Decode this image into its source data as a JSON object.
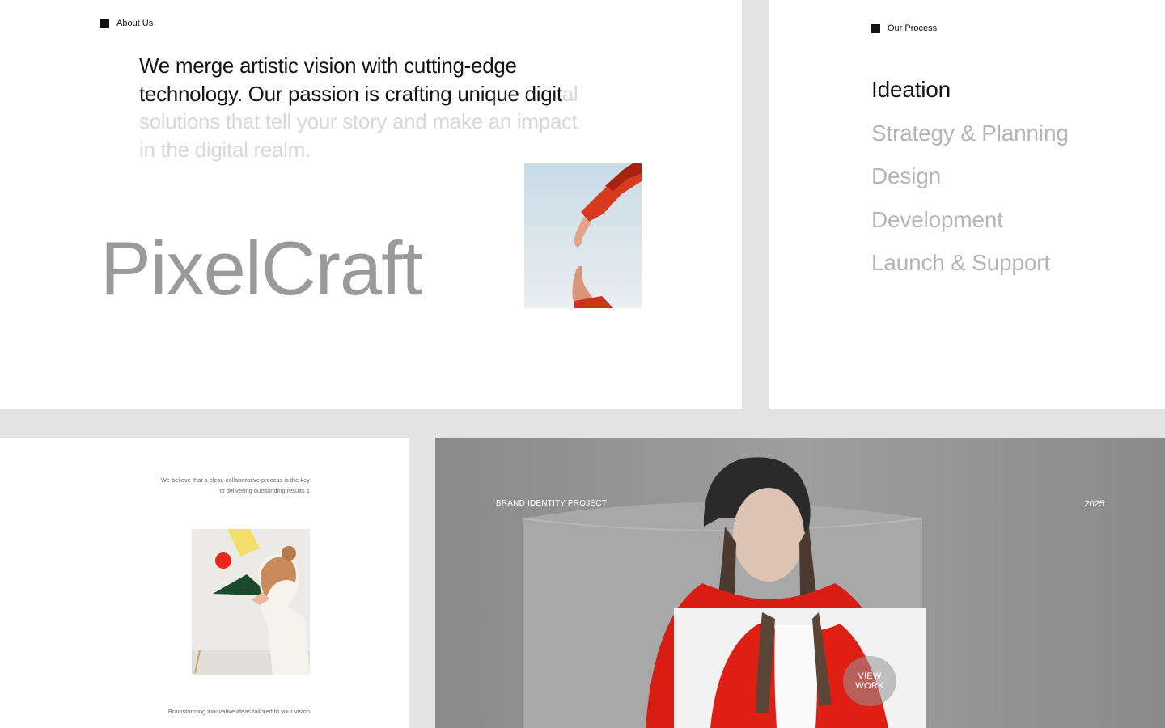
{
  "about": {
    "tag_label": "About Us",
    "lead_dark_1": "We merge artistic vision with cutting-edge",
    "lead_dark_2": "technology. Our passion is crafting unique digit",
    "lead_light_tail": "al",
    "lead_light_1": "solutions that tell your story and make an impact",
    "lead_light_2": "in the digital realm.",
    "brand_name": "PixelCraft"
  },
  "process": {
    "tag_label": "Our Process",
    "steps": [
      "Ideation",
      "Strategy & Planning",
      "Design",
      "Development",
      "Launch & Support"
    ]
  },
  "believe": {
    "caption_top_1": "We believe that a clear, collaborative process is the key",
    "caption_top_2": "to delivering outstanding results 1",
    "caption_bottom": "Brainstorming innovative ideas tailored to your vision"
  },
  "project": {
    "label": "BRAND IDENTITY PROJECT",
    "year": "2025",
    "view_line_1": "VIEW",
    "view_line_2": "WORK"
  },
  "colors": {
    "background": "#e3e3e3",
    "accent_red": "#e8281e",
    "text_dark": "#141414",
    "text_muted": "#b5b5b5"
  }
}
